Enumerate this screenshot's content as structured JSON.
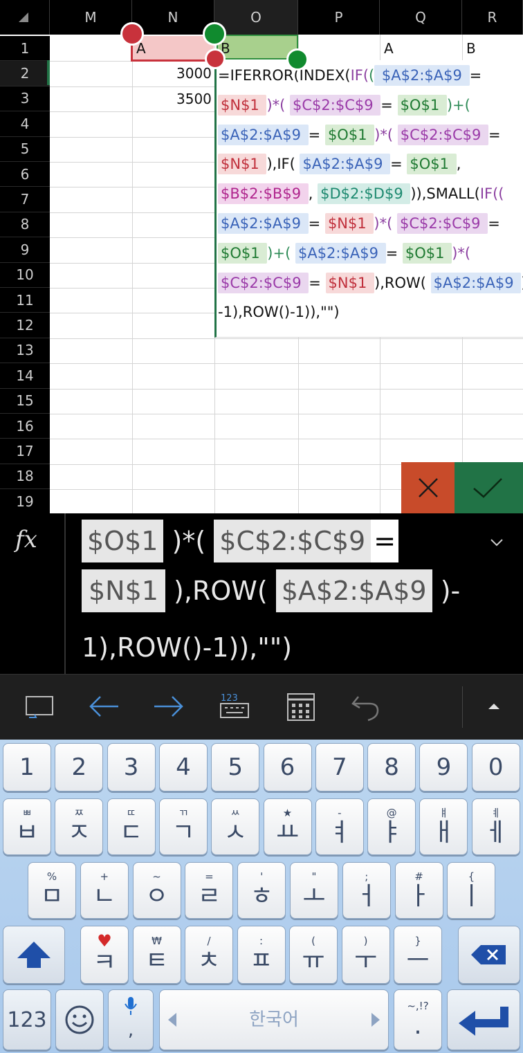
{
  "sheet": {
    "columns": [
      "M",
      "N",
      "O",
      "P",
      "Q",
      "R"
    ],
    "rows": [
      "1",
      "2",
      "3",
      "4",
      "5",
      "6",
      "7",
      "8",
      "9",
      "10",
      "11",
      "12",
      "13",
      "14",
      "15",
      "16",
      "17",
      "18",
      "19"
    ],
    "cells": {
      "N1": "A",
      "O1": "B",
      "Q1": "A",
      "R1": "B",
      "N2": "3000",
      "N3": "3500"
    }
  },
  "editor": {
    "lines": [
      [
        {
          "t": "=IFERROR(INDEX(",
          "c": "t"
        },
        {
          "t": "IF(",
          "c": "p1"
        },
        {
          "t": "(",
          "c": "p2"
        },
        {
          "t": " $A$2:$A$9 ",
          "c": "bl"
        },
        {
          "t": " =",
          "c": "t"
        }
      ],
      [
        {
          "t": " $N$1 ",
          "c": "rd"
        },
        {
          "t": " )*( ",
          "c": "p1"
        },
        {
          "t": " $C$2:$C$9 ",
          "c": "pu"
        },
        {
          "t": " = ",
          "c": "t"
        },
        {
          "t": " $O$1 ",
          "c": "gr"
        },
        {
          "t": " )+(",
          "c": "p2"
        }
      ],
      [
        {
          "t": " $A$2:$A$9 ",
          "c": "bl"
        },
        {
          "t": " = ",
          "c": "t"
        },
        {
          "t": " $O$1 ",
          "c": "gr"
        },
        {
          "t": " )*( ",
          "c": "p1"
        },
        {
          "t": " $C$2:$C$9 ",
          "c": "pu"
        },
        {
          "t": " =",
          "c": "t"
        }
      ],
      [
        {
          "t": " $N$1 ",
          "c": "rd"
        },
        {
          "t": " ),IF( ",
          "c": "t"
        },
        {
          "t": " $A$2:$A$9 ",
          "c": "bl"
        },
        {
          "t": " = ",
          "c": "t"
        },
        {
          "t": " $O$1 ",
          "c": "gr"
        },
        {
          "t": " ,",
          "c": "t"
        }
      ],
      [
        {
          "t": " $B$2:$B$9 ",
          "c": "pk"
        },
        {
          "t": " , ",
          "c": "t"
        },
        {
          "t": " $D$2:$D$9 ",
          "c": "tl"
        },
        {
          "t": " )),SMALL(",
          "c": "t"
        },
        {
          "t": "IF((",
          "c": "p1"
        }
      ],
      [
        {
          "t": " $A$2:$A$9 ",
          "c": "bl"
        },
        {
          "t": " = ",
          "c": "t"
        },
        {
          "t": " $N$1 ",
          "c": "rd"
        },
        {
          "t": " )*( ",
          "c": "p1"
        },
        {
          "t": " $C$2:$C$9 ",
          "c": "pu"
        },
        {
          "t": " =",
          "c": "t"
        }
      ],
      [
        {
          "t": " $O$1 ",
          "c": "gr"
        },
        {
          "t": " )+( ",
          "c": "p2"
        },
        {
          "t": " $A$2:$A$9 ",
          "c": "bl"
        },
        {
          "t": " = ",
          "c": "t"
        },
        {
          "t": " $O$1 ",
          "c": "gr"
        },
        {
          "t": " )*(",
          "c": "p1"
        }
      ],
      [
        {
          "t": " $C$2:$C$9 ",
          "c": "pu"
        },
        {
          "t": " = ",
          "c": "t"
        },
        {
          "t": " $N$1 ",
          "c": "rd"
        },
        {
          "t": " ),ROW( ",
          "c": "t"
        },
        {
          "t": " $A$2:$A$9 ",
          "c": "bl"
        },
        {
          "t": " )",
          "c": "t"
        }
      ],
      [
        {
          "t": "-1),ROW()-1)),\"\")",
          "c": "t"
        }
      ]
    ]
  },
  "buttons": {
    "cancel_icon": "close-icon",
    "ok_icon": "check-icon"
  },
  "formula_bar": {
    "fx_label": "fx",
    "line1": {
      "ref1": "$O$1",
      "mid": " )*( ",
      "ref2": "$C$2:$C$9",
      "sel": " = "
    },
    "line2": {
      "ref1": "$N$1",
      "mid": " ),ROW( ",
      "ref2": "$A$2:$A$9",
      "tail": " )-"
    },
    "line3": "1),ROW()-1)),\"\")"
  },
  "keyboard": {
    "row_numbers": [
      "1",
      "2",
      "3",
      "4",
      "5",
      "6",
      "7",
      "8",
      "9",
      "0"
    ],
    "row1": [
      [
        "ㅃ",
        "ㅂ"
      ],
      [
        "ㅉ",
        "ㅈ"
      ],
      [
        "ㄸ",
        "ㄷ"
      ],
      [
        "ㄲ",
        "ㄱ"
      ],
      [
        "ㅆ",
        "ㅅ"
      ],
      [
        "★",
        "ㅛ"
      ],
      [
        "-",
        "ㅕ"
      ],
      [
        "@",
        "ㅑ"
      ],
      [
        "ㅒ",
        "ㅐ"
      ],
      [
        "ㅖ",
        "ㅔ"
      ]
    ],
    "row2": [
      [
        "%",
        "ㅁ"
      ],
      [
        "+",
        "ㄴ"
      ],
      [
        "~",
        "ㅇ"
      ],
      [
        "=",
        "ㄹ"
      ],
      [
        "'",
        "ㅎ"
      ],
      [
        "\"",
        "ㅗ"
      ],
      [
        ";",
        "ㅓ"
      ],
      [
        "#",
        "ㅏ"
      ],
      [
        "{",
        "ㅣ"
      ]
    ],
    "row3": [
      [
        "♥",
        "ㅋ"
      ],
      [
        "₩",
        "ㅌ"
      ],
      [
        "/",
        "ㅊ"
      ],
      [
        ":",
        "ㅍ"
      ],
      [
        "(",
        "ㅠ"
      ],
      [
        ")",
        "ㅜ"
      ],
      [
        "}",
        "ㅡ"
      ]
    ],
    "mode_key": "123",
    "space_label": "한국어",
    "punct_top": "~,!?",
    "punct_bottom": ".",
    "mic_sub": ","
  },
  "colors": {
    "accent_green": "#217346",
    "cancel_red": "#c84b2a",
    "keyboard_bg": "#bcd6f0"
  }
}
